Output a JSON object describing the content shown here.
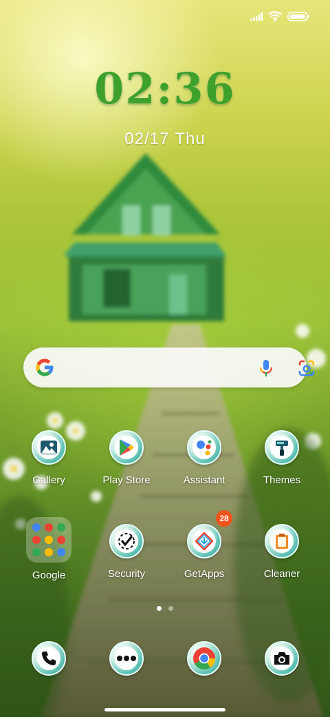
{
  "lockscreen": {
    "clock": "02:36",
    "date": "02/17",
    "day": "Thu"
  },
  "status_bar": {
    "icons": [
      "signal-icon",
      "wifi-icon",
      "battery-icon"
    ]
  },
  "search": {
    "icons": [
      "google-logo-icon",
      "microphone-icon",
      "google-lens-icon"
    ]
  },
  "apps_row1": [
    {
      "label": "Gallery",
      "icon": "gallery-icon"
    },
    {
      "label": "Play Store",
      "icon": "play-store-icon"
    },
    {
      "label": "Assistant",
      "icon": "assistant-icon"
    },
    {
      "label": "Themes",
      "icon": "themes-icon"
    }
  ],
  "apps_row2": [
    {
      "label": "Google",
      "icon": "google-folder-icon"
    },
    {
      "label": "Security",
      "icon": "security-icon"
    },
    {
      "label": "GetApps",
      "icon": "getapps-icon",
      "badge": "28"
    },
    {
      "label": "Cleaner",
      "icon": "cleaner-icon"
    }
  ],
  "dock": [
    {
      "icon": "phone-icon"
    },
    {
      "icon": "messages-icon"
    },
    {
      "icon": "chrome-icon"
    },
    {
      "icon": "camera-icon"
    }
  ],
  "pagination": {
    "current_page": 1,
    "total_pages": 2
  },
  "colors": {
    "clock": "#3ea12b",
    "badge": "#f2541b",
    "google_blue": "#4285f4",
    "google_red": "#ea4335",
    "google_yellow": "#fbbc05",
    "google_green": "#34a853"
  }
}
